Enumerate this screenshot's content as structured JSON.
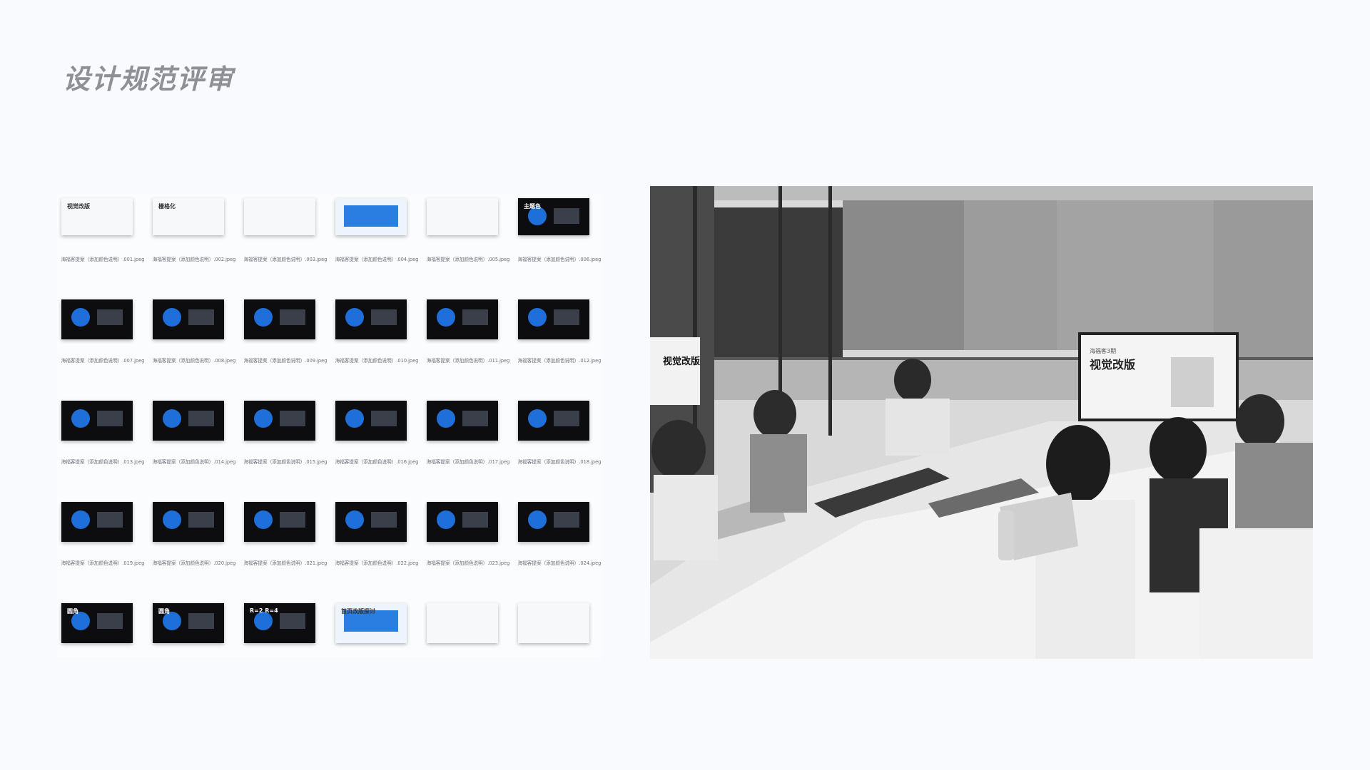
{
  "page": {
    "title": "设计规范评审"
  },
  "thumbnails": [
    {
      "file": "海福客提案（添加颜色说明）.001.jpeg",
      "label": "视觉改版",
      "theme": "light"
    },
    {
      "file": "海福客提案（添加颜色说明）.002.jpeg",
      "label": "栅格化",
      "theme": "light"
    },
    {
      "file": "海福客提案（添加颜色说明）.003.jpeg",
      "label": "",
      "theme": "light"
    },
    {
      "file": "海福客提案（添加颜色说明）.004.jpeg",
      "label": "",
      "theme": "blue"
    },
    {
      "file": "海福客提案（添加颜色说明）.005.jpeg",
      "label": "",
      "theme": "light"
    },
    {
      "file": "海福客提案（添加颜色说明）.006.jpeg",
      "label": "主题色",
      "theme": "dark"
    },
    {
      "file": "海福客提案（添加颜色说明）.007.jpeg",
      "label": "",
      "theme": "dark"
    },
    {
      "file": "海福客提案（添加颜色说明）.008.jpeg",
      "label": "",
      "theme": "dark"
    },
    {
      "file": "海福客提案（添加颜色说明）.009.jpeg",
      "label": "",
      "theme": "dark"
    },
    {
      "file": "海福客提案（添加颜色说明）.010.jpeg",
      "label": "",
      "theme": "dark"
    },
    {
      "file": "海福客提案（添加颜色说明）.011.jpeg",
      "label": "",
      "theme": "dark"
    },
    {
      "file": "海福客提案（添加颜色说明）.012.jpeg",
      "label": "",
      "theme": "dark"
    },
    {
      "file": "海福客提案（添加颜色说明）.013.jpeg",
      "label": "",
      "theme": "dark"
    },
    {
      "file": "海福客提案（添加颜色说明）.014.jpeg",
      "label": "",
      "theme": "dark"
    },
    {
      "file": "海福客提案（添加颜色说明）.015.jpeg",
      "label": "",
      "theme": "dark"
    },
    {
      "file": "海福客提案（添加颜色说明）.016.jpeg",
      "label": "",
      "theme": "dark"
    },
    {
      "file": "海福客提案（添加颜色说明）.017.jpeg",
      "label": "",
      "theme": "dark"
    },
    {
      "file": "海福客提案（添加颜色说明）.018.jpeg",
      "label": "",
      "theme": "dark"
    },
    {
      "file": "海福客提案（添加颜色说明）.019.jpeg",
      "label": "",
      "theme": "dark"
    },
    {
      "file": "海福客提案（添加颜色说明）.020.jpeg",
      "label": "",
      "theme": "dark"
    },
    {
      "file": "海福客提案（添加颜色说明）.021.jpeg",
      "label": "",
      "theme": "dark"
    },
    {
      "file": "海福客提案（添加颜色说明）.022.jpeg",
      "label": "",
      "theme": "dark"
    },
    {
      "file": "海福客提案（添加颜色说明）.023.jpeg",
      "label": "",
      "theme": "dark"
    },
    {
      "file": "海福客提案（添加颜色说明）.024.jpeg",
      "label": "",
      "theme": "dark"
    },
    {
      "file": "",
      "label": "圆角",
      "theme": "dark"
    },
    {
      "file": "",
      "label": "圆角",
      "theme": "dark"
    },
    {
      "file": "",
      "label": "R=2 R=4",
      "theme": "dark"
    },
    {
      "file": "",
      "label": "首页改版探讨",
      "theme": "blue"
    },
    {
      "file": "",
      "label": "",
      "theme": "light"
    },
    {
      "file": "",
      "label": "",
      "theme": "light"
    }
  ],
  "photo": {
    "screen_small": "海福客3期",
    "screen_title": "视觉改版",
    "banner_title": "视觉改版"
  }
}
